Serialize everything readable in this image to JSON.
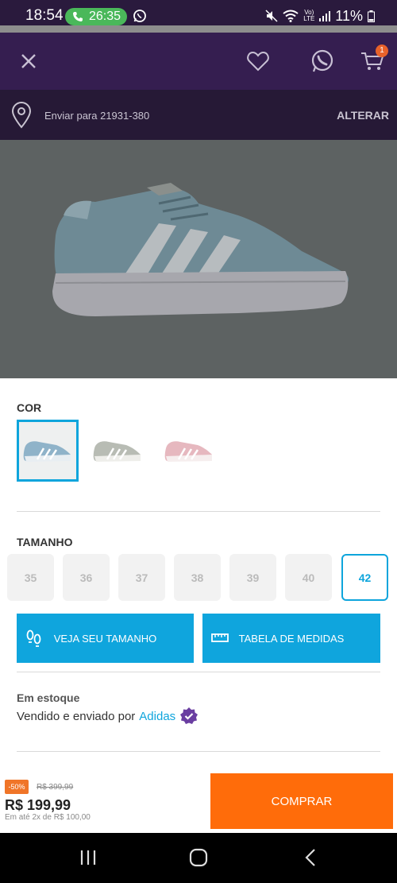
{
  "status_bar": {
    "time": "18:54",
    "call_timer": "26:35",
    "battery": "11%",
    "lte_line1": "Vo)",
    "lte_line2": "LTE"
  },
  "header": {
    "icons": [
      "close-icon",
      "heart-icon",
      "whatsapp-icon",
      "cart-icon"
    ],
    "cart_count": "1"
  },
  "address": {
    "text": "Enviar para 21931-380",
    "change_label": "ALTERAR"
  },
  "colors": {
    "title": "COR",
    "selected_index": 0,
    "options": [
      {
        "color": "#8fb3c9"
      },
      {
        "color": "#b8bcb4"
      },
      {
        "color": "#e6b8bf"
      }
    ]
  },
  "sizes": {
    "title": "TAMANHO",
    "options": [
      "35",
      "36",
      "37",
      "38",
      "39",
      "40",
      "42"
    ],
    "selected": "42"
  },
  "actions": {
    "size_guide": "VEJA SEU TAMANHO",
    "measure_table": "TABELA DE MEDIDAS"
  },
  "availability": {
    "stock": "Em estoque",
    "sold_by_prefix": "Vendido e enviado por",
    "seller": "Adidas"
  },
  "purchase": {
    "discount": "-50%",
    "old_price": "R$ 399,99",
    "price": "R$ 199,99",
    "installments": "Em até 2x de R$ 100,00",
    "buy_label": "COMPRAR"
  },
  "colors_theme": {
    "header_bg": "#351e50",
    "accent_blue": "#0fa5dd",
    "buy_orange": "#ff6c0a"
  }
}
